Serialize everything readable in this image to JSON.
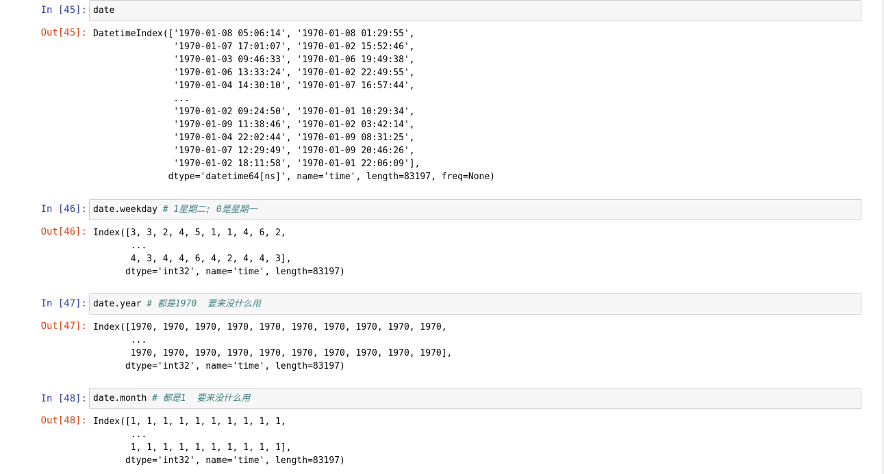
{
  "cells": [
    {
      "in_prompt": "In [45]:",
      "code": "date",
      "comment": "",
      "out_prompt": "Out[45]:",
      "output": "DatetimeIndex(['1970-01-08 05:06:14', '1970-01-08 01:29:55',\n               '1970-01-07 17:01:07', '1970-01-02 15:52:46',\n               '1970-01-03 09:46:33', '1970-01-06 19:49:38',\n               '1970-01-06 13:33:24', '1970-01-02 22:49:55',\n               '1970-01-04 14:30:10', '1970-01-07 16:57:44',\n               ...\n               '1970-01-02 09:24:50', '1970-01-01 10:29:34',\n               '1970-01-09 11:38:46', '1970-01-02 03:42:14',\n               '1970-01-04 22:02:44', '1970-01-09 08:31:25',\n               '1970-01-07 12:29:49', '1970-01-09 20:46:26',\n               '1970-01-02 18:11:58', '1970-01-01 22:06:09'],\n              dtype='datetime64[ns]', name='time', length=83197, freq=None)"
    },
    {
      "in_prompt": "In [46]:",
      "code": "date.weekday ",
      "comment": "# 1星期二; 0是星期一",
      "out_prompt": "Out[46]:",
      "output": "Index([3, 3, 2, 4, 5, 1, 1, 4, 6, 2,\n       ...\n       4, 3, 4, 4, 6, 4, 2, 4, 4, 3],\n      dtype='int32', name='time', length=83197)"
    },
    {
      "in_prompt": "In [47]:",
      "code": "date.year ",
      "comment": "# 都是1970  要来没什么用",
      "out_prompt": "Out[47]:",
      "output": "Index([1970, 1970, 1970, 1970, 1970, 1970, 1970, 1970, 1970, 1970,\n       ...\n       1970, 1970, 1970, 1970, 1970, 1970, 1970, 1970, 1970, 1970],\n      dtype='int32', name='time', length=83197)"
    },
    {
      "in_prompt": "In [48]:",
      "code": "date.month ",
      "comment": "# 都是1  要来没什么用",
      "out_prompt": "Out[48]:",
      "output": "Index([1, 1, 1, 1, 1, 1, 1, 1, 1, 1,\n       ...\n       1, 1, 1, 1, 1, 1, 1, 1, 1, 1],\n      dtype='int32', name='time', length=83197)"
    }
  ]
}
